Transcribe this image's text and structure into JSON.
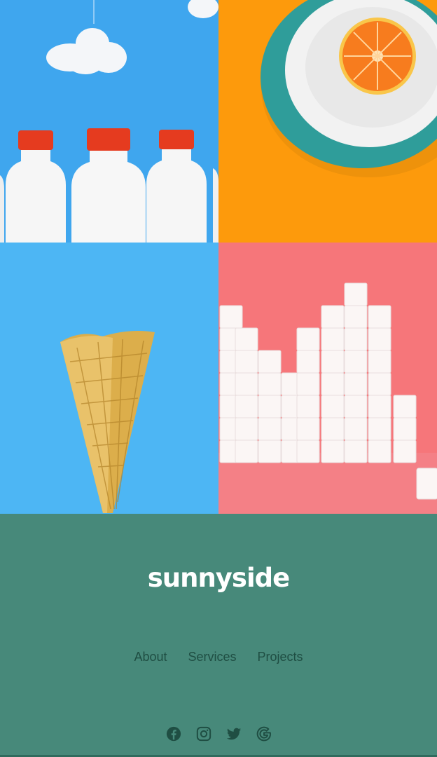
{
  "brand": {
    "logo_text": "sunnyside"
  },
  "gallery": {
    "tiles": [
      {
        "subject": "milk-bottles",
        "bg_color": "#3fa6ee"
      },
      {
        "subject": "orange-on-plate",
        "bg_color": "#fd9a0c"
      },
      {
        "subject": "ice-cream-cone",
        "bg_color": "#4db6f4"
      },
      {
        "subject": "sugar-cubes",
        "bg_color": "#f6767a"
      }
    ]
  },
  "footer": {
    "bg_color": "#47897a",
    "nav": [
      {
        "label": "About"
      },
      {
        "label": "Services"
      },
      {
        "label": "Projects"
      }
    ],
    "social_icons": [
      "facebook-icon",
      "instagram-icon",
      "twitter-icon",
      "google-icon"
    ],
    "icon_color": "#1f4e43"
  }
}
